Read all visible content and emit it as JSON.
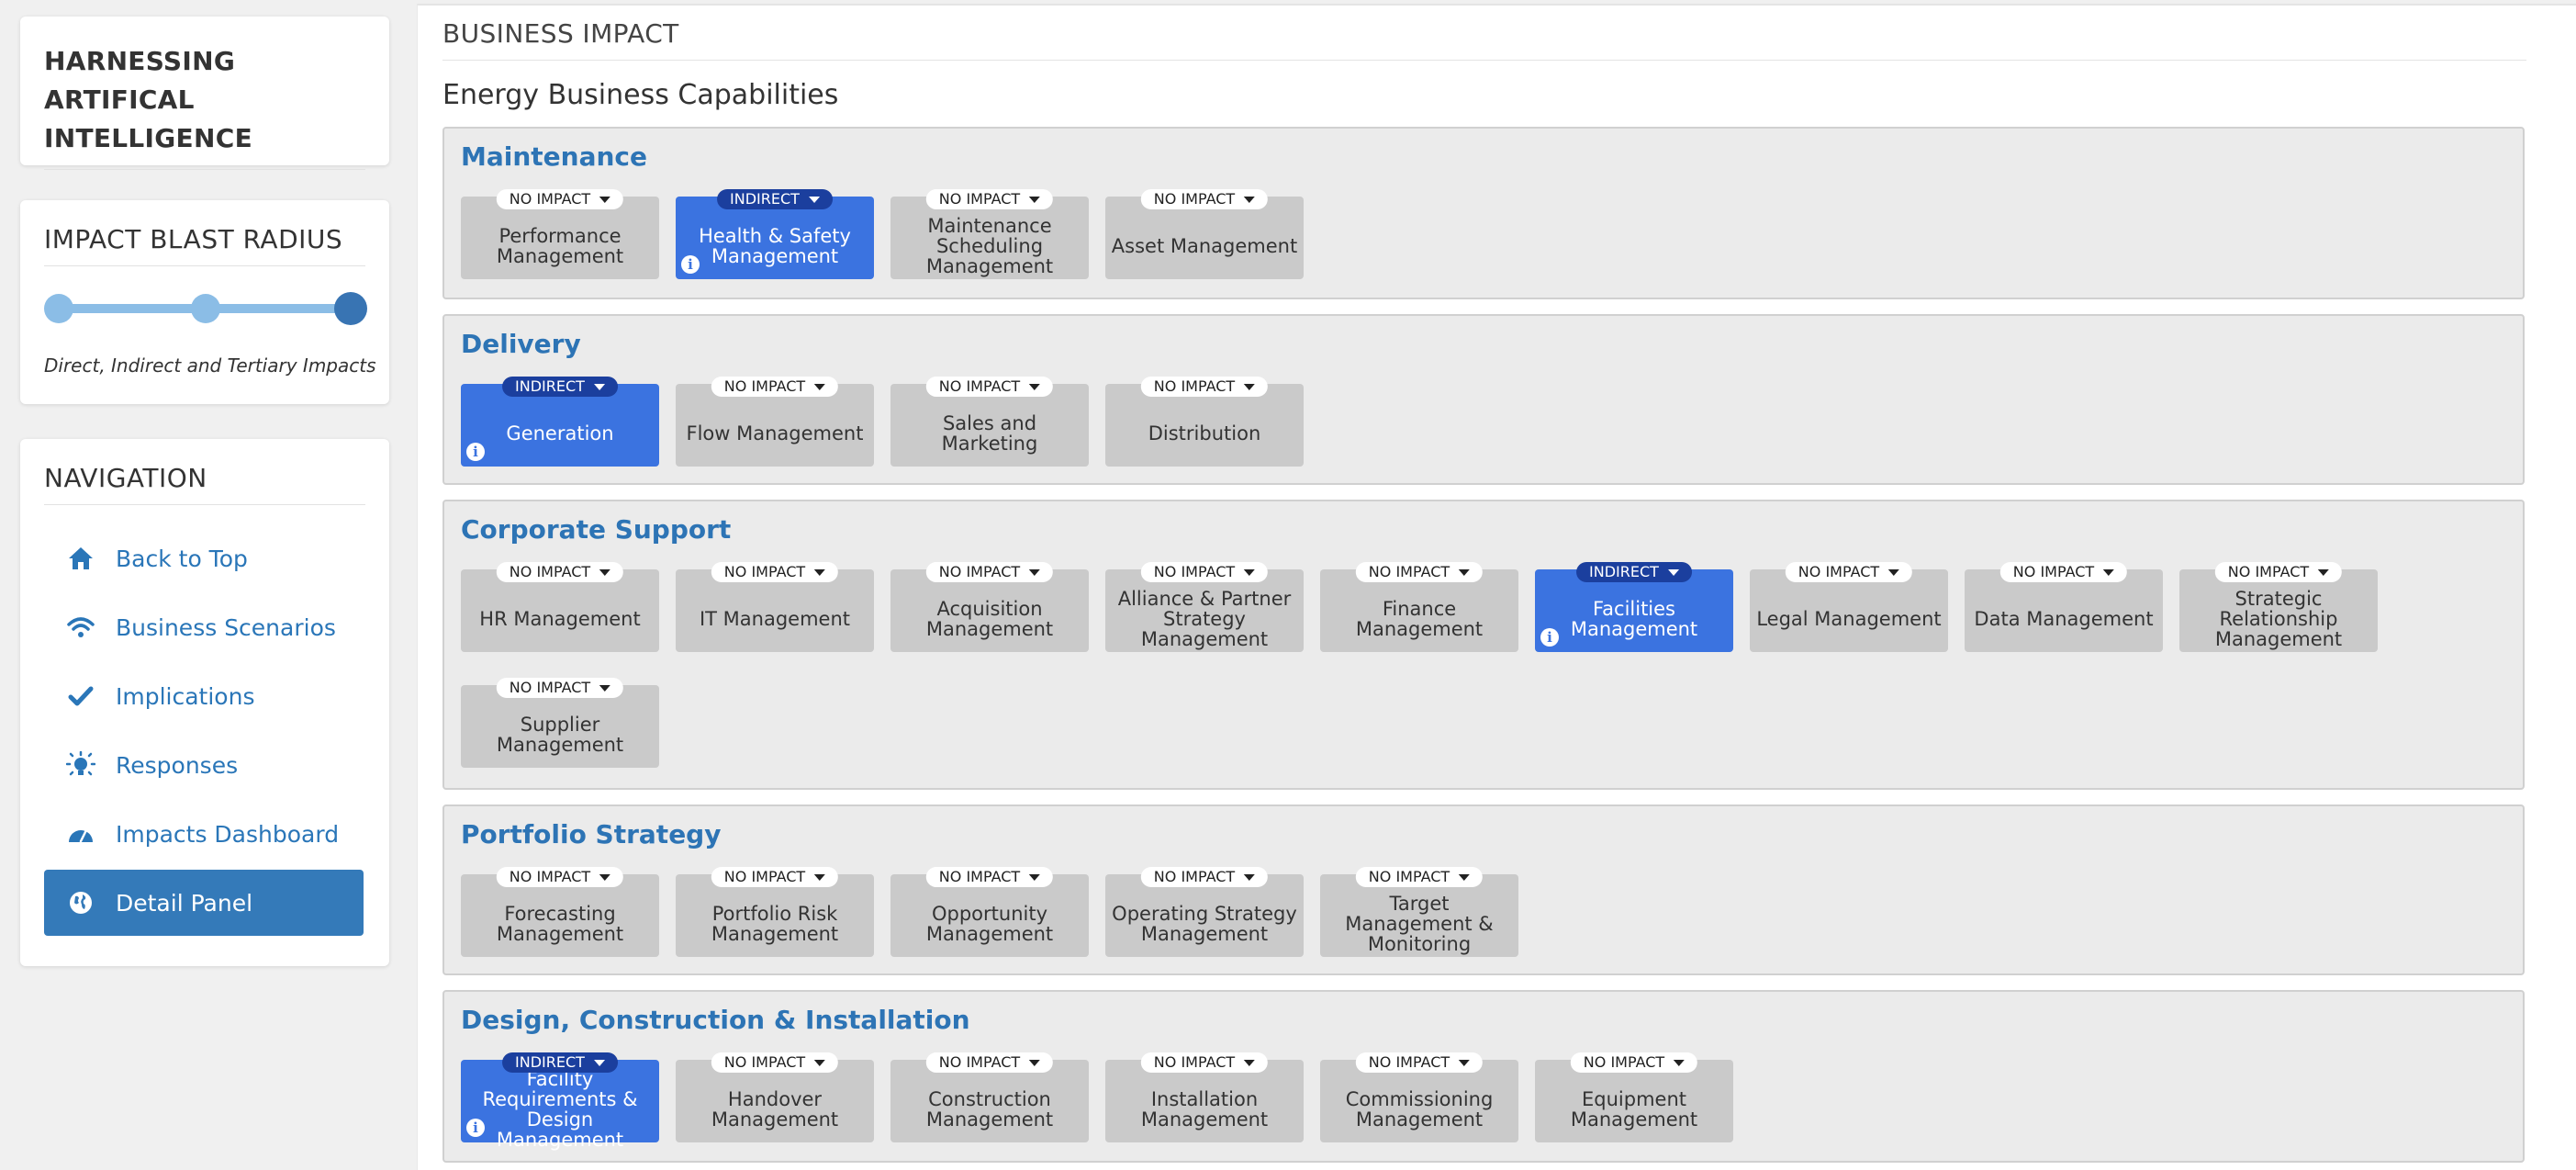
{
  "app": {
    "title": "HARNESSING ARTIFICAL INTELLIGENCE"
  },
  "blast_radius": {
    "heading": "IMPACT BLAST RADIUS",
    "level": 3,
    "levels": 3,
    "caption": "Direct, Indirect and Tertiary Impacts"
  },
  "navigation": {
    "heading": "NAVIGATION",
    "items": [
      {
        "label": "Back to Top",
        "icon": "home-icon",
        "active": false
      },
      {
        "label": "Business Scenarios",
        "icon": "wifi-icon",
        "active": false
      },
      {
        "label": "Implications",
        "icon": "check-icon",
        "active": false
      },
      {
        "label": "Responses",
        "icon": "lightbulb-icon",
        "active": false
      },
      {
        "label": "Impacts Dashboard",
        "icon": "dashboard-icon",
        "active": false
      },
      {
        "label": "Detail Panel",
        "icon": "globe-icon",
        "active": true
      }
    ]
  },
  "main": {
    "header": "BUSINESS IMPACT",
    "subtitle": "Energy Business Capabilities",
    "sections": [
      {
        "title": "Maintenance",
        "tiles": [
          {
            "label": "Performance Management",
            "impact": "NO IMPACT"
          },
          {
            "label": "Health & Safety Management",
            "impact": "INDIRECT"
          },
          {
            "label": "Maintenance Scheduling Management",
            "impact": "NO IMPACT"
          },
          {
            "label": "Asset Management",
            "impact": "NO IMPACT"
          }
        ]
      },
      {
        "title": "Delivery",
        "tiles": [
          {
            "label": "Generation",
            "impact": "INDIRECT"
          },
          {
            "label": "Flow Management",
            "impact": "NO IMPACT"
          },
          {
            "label": "Sales and Marketing",
            "impact": "NO IMPACT"
          },
          {
            "label": "Distribution",
            "impact": "NO IMPACT"
          }
        ]
      },
      {
        "title": "Corporate Support",
        "tiles": [
          {
            "label": "HR Management",
            "impact": "NO IMPACT"
          },
          {
            "label": "IT Management",
            "impact": "NO IMPACT"
          },
          {
            "label": "Acquisition Management",
            "impact": "NO IMPACT"
          },
          {
            "label": "Alliance & Partner Strategy Management",
            "impact": "NO IMPACT"
          },
          {
            "label": "Finance Management",
            "impact": "NO IMPACT"
          },
          {
            "label": "Facilities Management",
            "impact": "INDIRECT"
          },
          {
            "label": "Legal Management",
            "impact": "NO IMPACT"
          },
          {
            "label": "Data Management",
            "impact": "NO IMPACT"
          },
          {
            "label": "Strategic Relationship Management",
            "impact": "NO IMPACT"
          },
          {
            "label": "Supplier Management",
            "impact": "NO IMPACT"
          }
        ]
      },
      {
        "title": "Portfolio Strategy",
        "tiles": [
          {
            "label": "Forecasting Management",
            "impact": "NO IMPACT"
          },
          {
            "label": "Portfolio Risk Management",
            "impact": "NO IMPACT"
          },
          {
            "label": "Opportunity Management",
            "impact": "NO IMPACT"
          },
          {
            "label": "Operating Strategy Management",
            "impact": "NO IMPACT"
          },
          {
            "label": "Target Management & Monitoring",
            "impact": "NO IMPACT"
          }
        ]
      },
      {
        "title": "Design, Construction & Installation",
        "tiles": [
          {
            "label": "Facility Requirements & Design Management",
            "impact": "INDIRECT"
          },
          {
            "label": "Handover Management",
            "impact": "NO IMPACT"
          },
          {
            "label": "Construction Management",
            "impact": "NO IMPACT"
          },
          {
            "label": "Installation Management",
            "impact": "NO IMPACT"
          },
          {
            "label": "Commissioning Management",
            "impact": "NO IMPACT"
          },
          {
            "label": "Equipment Management",
            "impact": "NO IMPACT"
          }
        ]
      }
    ]
  },
  "colors": {
    "accent": "#2d74b5",
    "indirect_tile": "#3b73e0",
    "indirect_badge": "#1b3f9e",
    "no_impact_tile": "#cacaca",
    "nav_active": "#347ab9"
  }
}
